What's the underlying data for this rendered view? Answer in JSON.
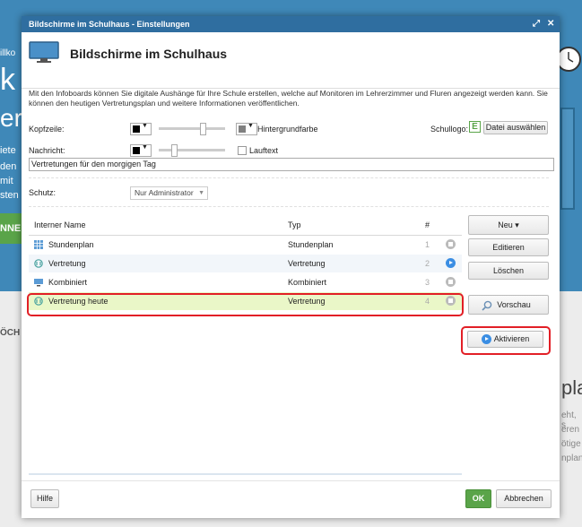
{
  "background": {
    "fragments": [
      "illko",
      "k",
      "ere",
      "iete",
      "den",
      "mit",
      "sten",
      "NNE",
      "ÖCH",
      "pla",
      "eht, s",
      "eren",
      "ötige",
      "nplan"
    ],
    "colors": {
      "header_bg": "#3f88b8",
      "green_button": "#5aa449"
    }
  },
  "window": {
    "title": "Bildschirme im Schulhaus - Einstellungen",
    "maximize_icon": "expand-icon",
    "close_icon": "close-icon"
  },
  "header": {
    "title": "Bildschirme im Schulhaus",
    "icon": "monitor-icon"
  },
  "description": "Mit den Infoboards können Sie digitale Aushänge für Ihre Schule erstellen, welche auf Monitoren im Lehrerzimmer und Fluren angezeigt werden kann. Sie können den heutigen Vertretungsplan und weitere Informationen veröffentlichen.",
  "settings": {
    "kopfzeile_label": "Kopfzeile:",
    "hintergrundfarbe_label": "Hintergrundfarbe",
    "schullogo_label": "Schullogo:",
    "datei_button": "Datei auswählen",
    "nachricht_label": "Nachricht:",
    "lauftext_label": "Lauftext",
    "lauftext_checked": false,
    "nachricht_value": "Vertretungen für den morgigen Tag",
    "schutz_label": "Schutz:",
    "schutz_value": "Nur Administrator",
    "kopfzeile_color": "#000000",
    "hintergrund_color": "#808080",
    "nachricht_color": "#000000"
  },
  "table": {
    "columns": {
      "name": "Interner Name",
      "typ": "Typ",
      "num": "#"
    },
    "rows": [
      {
        "name": "Stundenplan",
        "typ": "Stundenplan",
        "num": "1",
        "icon": "grid-icon",
        "status": "inactive"
      },
      {
        "name": "Vertretung",
        "typ": "Vertretung",
        "num": "2",
        "icon": "substitution-icon",
        "status": "active"
      },
      {
        "name": "Kombiniert",
        "typ": "Kombiniert",
        "num": "3",
        "icon": "monitor-small-icon",
        "status": "inactive"
      },
      {
        "name": "Vertretung heute",
        "typ": "Vertretung",
        "num": "4",
        "icon": "substitution-icon",
        "status": "inactive"
      }
    ]
  },
  "actions": {
    "neu": "Neu ▾",
    "editieren": "Editieren",
    "loeschen": "Löschen",
    "vorschau": "Vorschau",
    "aktivieren": "Aktivieren"
  },
  "footer": {
    "hilfe": "Hilfe",
    "ok": "OK",
    "abbrechen": "Abbrechen"
  }
}
